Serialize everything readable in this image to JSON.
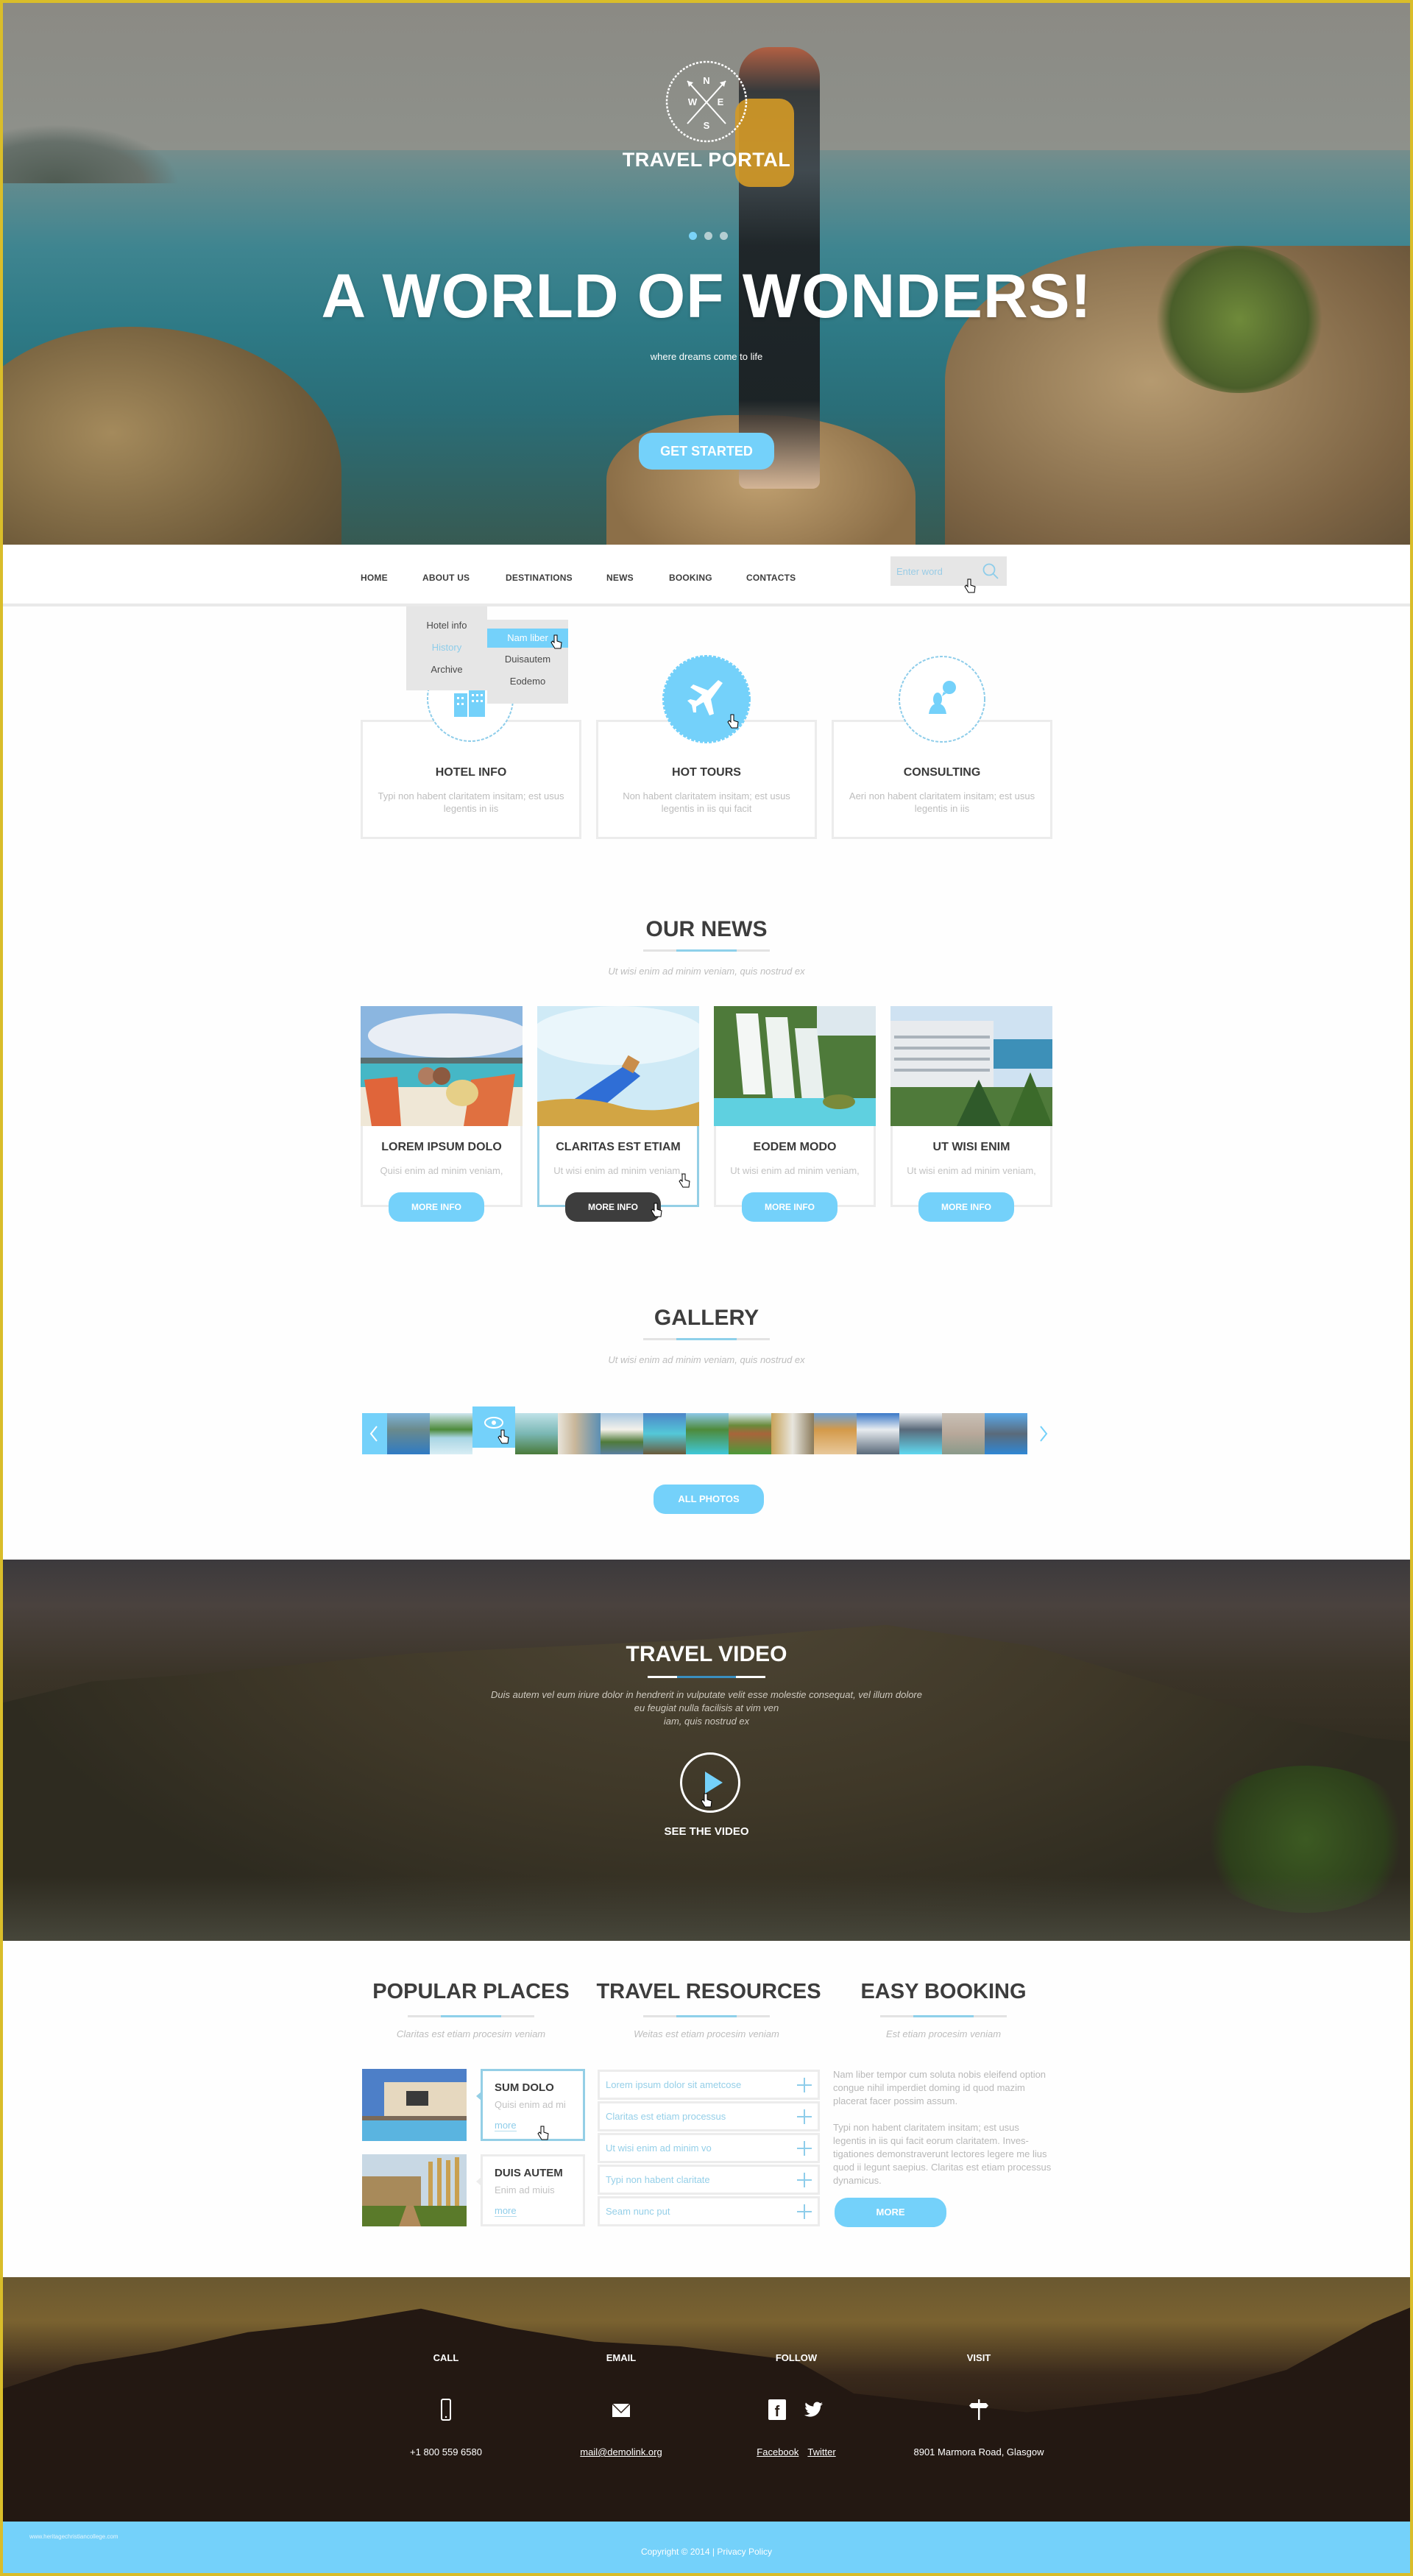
{
  "hero": {
    "logo_compass": [
      "N",
      "E",
      "S",
      "W"
    ],
    "logo_text": "TRAVEL PORTAL",
    "slider_dots": 3,
    "active_dot": 1,
    "title": "A WORLD OF WONDERS!",
    "subtitle": "where dreams come to life",
    "cta_label": "GET STARTED"
  },
  "nav": {
    "items": [
      {
        "label": "HOME"
      },
      {
        "label": "ABOUT US"
      },
      {
        "label": "DESTINATIONS"
      },
      {
        "label": "NEWS"
      },
      {
        "label": "BOOKING"
      },
      {
        "label": "CONTACTS"
      }
    ],
    "search_placeholder": "Enter word",
    "about_dropdown": [
      "Hotel info",
      "History",
      "Archive"
    ],
    "about_dropdown_active": "History",
    "history_submenu": [
      "Nam liber",
      "Duisautem",
      "Eodemo"
    ],
    "history_submenu_selected": "Nam liber"
  },
  "features": [
    {
      "icon": "hotel-building-icon",
      "title": "HOTEL INFO",
      "desc": "Typi non habent claritatem insitam; est usus legentis in iis"
    },
    {
      "icon": "airplane-icon",
      "title": "HOT TOURS",
      "desc": "Non habent claritatem insitam; est usus legentis in iis qui facit"
    },
    {
      "icon": "consulting-chat-icon",
      "title": "CONSULTING",
      "desc": "Aeri non habent claritatem insitam; est usus legentis in iis"
    }
  ],
  "news": {
    "title": "OUR NEWS",
    "subtitle": "Ut wisi enim ad minim veniam, quis nostrud ex",
    "items": [
      {
        "title": "LOREM IPSUM DOLO",
        "desc": "Quisi enim ad minim veniam,",
        "button": "MORE INFO",
        "image": "beach-couple"
      },
      {
        "title": "CLARITAS EST ETIAM",
        "desc": "Ut wisi enim ad minim veniam,",
        "button": "MORE INFO",
        "image": "bottle-on-beach"
      },
      {
        "title": "EODEM MODO",
        "desc": "Ut wisi enim ad minim veniam,",
        "button": "MORE INFO",
        "image": "waterfall"
      },
      {
        "title": "UT WISI ENIM",
        "desc": "Ut wisi enim ad minim veniam,",
        "button": "MORE INFO",
        "image": "resort-hotel"
      }
    ]
  },
  "gallery": {
    "title": "GALLERY",
    "subtitle": "Ut wisi enim ad minim veniam, quis nostrud ex",
    "thumbnails": 15,
    "selected_thumbnail": 3,
    "button": "ALL PHOTOS"
  },
  "video": {
    "title": "TRAVEL VIDEO",
    "desc_lines": [
      "Duis autem vel eum iriure dolor in hendrerit in vulputate velit esse molestie consequat, vel illum dolore",
      "eu feugiat nulla facilisis at vim ven",
      "iam, quis nostrud ex"
    ],
    "cta": "SEE THE VIDEO"
  },
  "popular_places": {
    "title": "POPULAR PLACES",
    "subtitle": "Claritas est etiam procesim veniam",
    "items": [
      {
        "title": "SUM DOLO",
        "desc": "Quisi enim ad mi",
        "link": "more",
        "image": "villa-pool"
      },
      {
        "title": "DUIS AUTEM",
        "desc": "Enim ad miuis",
        "link": "more",
        "image": "colosseum"
      }
    ]
  },
  "travel_resources": {
    "title": "TRAVEL RESOURCES",
    "subtitle": "Weitas est etiam procesim veniam",
    "items": [
      "Lorem ipsum dolor sit ametcose",
      "Claritas est etiam processus",
      "Ut wisi enim ad minim vo",
      "Typi non habent claritate",
      "Seam nunc put"
    ]
  },
  "easy_booking": {
    "title": "EASY BOOKING",
    "subtitle": "Est etiam procesim veniam",
    "para1": "Nam liber tempor cum soluta nobis eleifend option congue nihil imperdiet doming id quod mazim placerat facer possim assum.",
    "para2": "Typi non habent claritatem insitam; est usus legentis in iis qui facit eorum claritatem. Inves-tigationes demonstraverunt lectores legere me lius quod ii legunt saepius. Claritas est etiam processus dynamicus.",
    "button": "MORE"
  },
  "footer": {
    "call": {
      "head": "CALL",
      "value": "+1 800 559 6580"
    },
    "email": {
      "head": "EMAIL",
      "value": "mail@demolink.org"
    },
    "follow": {
      "head": "FOLLOW",
      "links": [
        "Facebook",
        "Twitter"
      ]
    },
    "visit": {
      "head": "VISIT",
      "value": "8901 Marmora Road, Glasgow"
    },
    "copyright": "Copyright © 2014 | ",
    "privacy": "Privacy Policy",
    "watermark": "www.heritagechristiancollege.com"
  },
  "colors": {
    "accent": "#74d1fa",
    "heading": "#3d3d3d",
    "muted": "#bdbdbd",
    "frame": "#d9bd2a",
    "dark_button": "#3d3d3d"
  }
}
